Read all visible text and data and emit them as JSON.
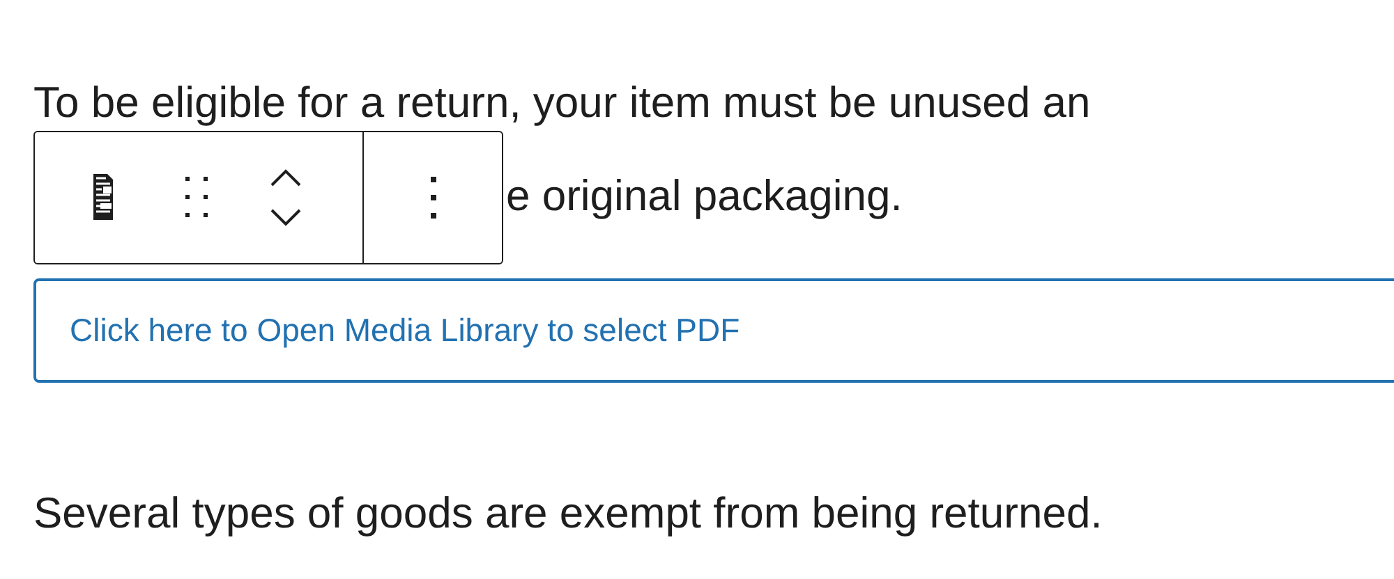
{
  "paragraph_1": {
    "line_1": "To be eligible for a return, your item must be unused an",
    "line_2": "e original packaging."
  },
  "pdf_button": {
    "label": "Click here to Open Media Library to select PDF"
  },
  "paragraph_2": {
    "text": "Several types of goods are exempt from being returned."
  }
}
